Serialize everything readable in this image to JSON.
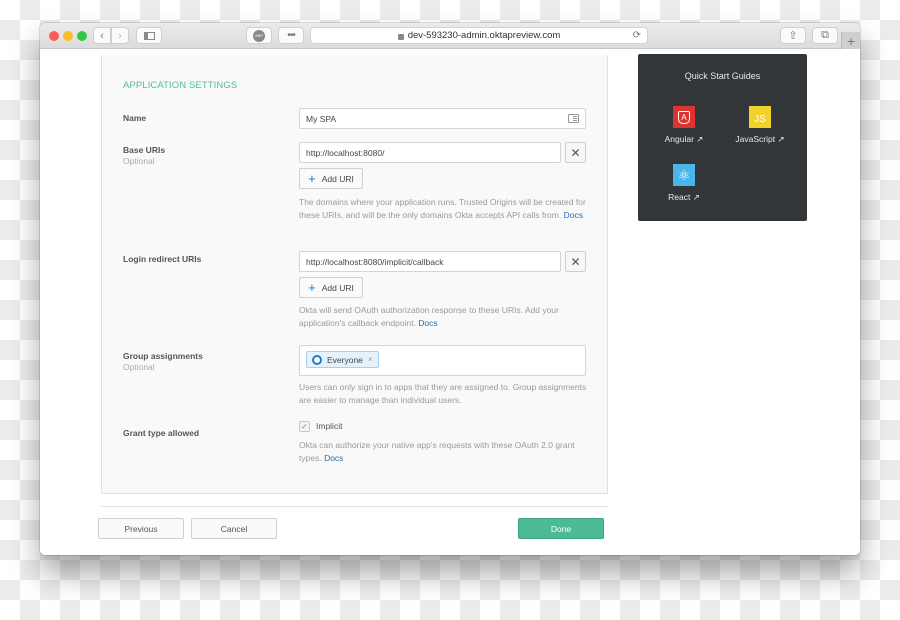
{
  "browser": {
    "url": "dev-593230-admin.oktapreview.com",
    "back_label": "‹",
    "forward_label": "›",
    "more_label": "•••",
    "reload_icon": "⟳",
    "share_icon": "⇧",
    "tabs_icon": "⧉",
    "new_tab_label": "+",
    "abp_label": "ABP"
  },
  "form": {
    "section_title": "APPLICATION SETTINGS",
    "name": {
      "label": "Name",
      "value": "My SPA"
    },
    "base_uris": {
      "label": "Base URIs",
      "sublabel": "Optional",
      "value": "http://localhost:8080/",
      "add_label": "Add URI",
      "help": "The domains where your application runs. Trusted Origins will be created for these URIs, and will be the only domains Okta accepts API calls from.",
      "help_link": "Docs"
    },
    "login_redirect": {
      "label": "Login redirect URIs",
      "value": "http://localhost:8080/implicit/callback",
      "add_label": "Add URI",
      "help": "Okta will send OAuth authorization response to these URIs. Add your application's callback endpoint.",
      "help_link": "Docs"
    },
    "group_assignments": {
      "label": "Group assignments",
      "sublabel": "Optional",
      "chip": "Everyone",
      "chip_remove": "×",
      "help": "Users can only sign in to apps that they are assigned to. Group assignments are easier to manage than individual users."
    },
    "grant_type": {
      "label": "Grant type allowed",
      "option": "Implicit",
      "checked": true,
      "help": "Okta can authorize your native app's requests with these OAuth 2.0 grant types.",
      "help_link": "Docs"
    },
    "remove_icon": "✕",
    "plus_icon": "+"
  },
  "footer": {
    "previous": "Previous",
    "cancel": "Cancel",
    "done": "Done"
  },
  "quick_start": {
    "title": "Quick Start Guides",
    "items": [
      {
        "label": "Angular ↗",
        "logo": "A",
        "color": "#dd3333"
      },
      {
        "label": "JavaScript ↗",
        "logo": "JS",
        "color": "#f0d22a"
      },
      {
        "label": "React ↗",
        "logo": "⚛",
        "color": "#4ab5e8"
      }
    ]
  }
}
